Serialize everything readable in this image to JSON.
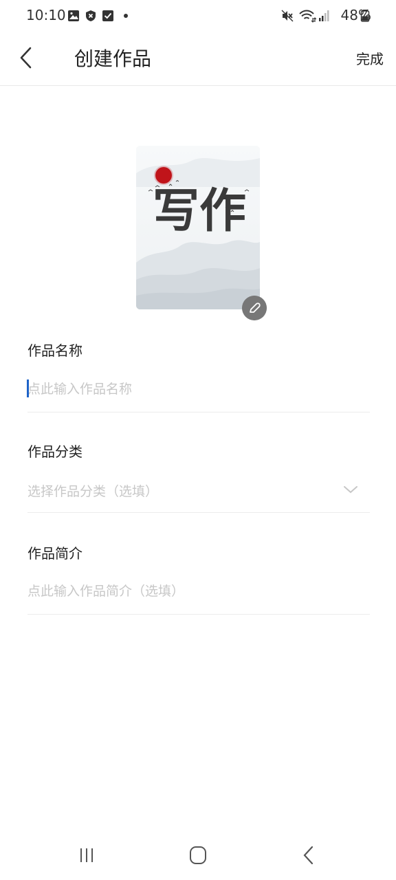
{
  "status_bar": {
    "time": "10:10",
    "battery": "48%",
    "icons": [
      "gallery-icon",
      "shield-icon",
      "checkbox-icon",
      "dot-icon",
      "mute-icon",
      "wifi-icon",
      "signal-icon",
      "battery-icon"
    ]
  },
  "app_bar": {
    "title": "创建作品",
    "done_label": "完成"
  },
  "cover": {
    "calligraphy_text": "写作"
  },
  "form": {
    "name": {
      "label": "作品名称",
      "placeholder": "点此输入作品名称"
    },
    "category": {
      "label": "作品分类",
      "placeholder": "选择作品分类（选填）"
    },
    "intro": {
      "label": "作品简介",
      "placeholder": "点此输入作品简介（选填）"
    }
  },
  "colors": {
    "caret": "#1e63c8",
    "placeholder": "#c7c7c7",
    "sun": "#c0141a"
  }
}
